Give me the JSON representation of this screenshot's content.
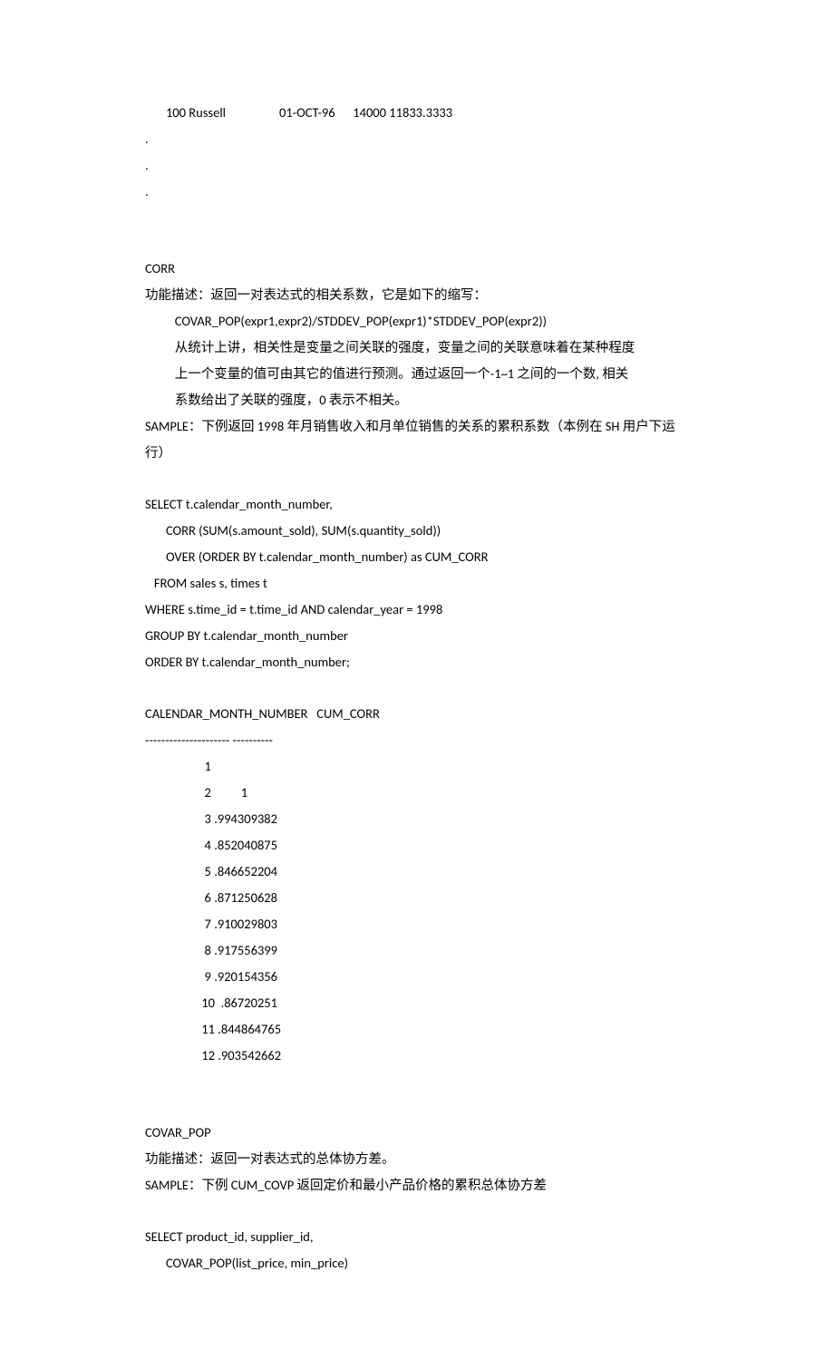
{
  "header_row": "       100 Russell                  01-OCT-96      14000 11833.3333",
  "dot1": ".",
  "dot2": ".",
  "dot3": ".",
  "corr": {
    "title": "CORR",
    "desc_label": "功能描述：返回一对表达式的相关系数，它是如下的缩写：",
    "formula": "          COVAR_POP(expr1,expr2)/STDDEV_POP(expr1)*STDDEV_POP(expr2))",
    "note1": "          从统计上讲，相关性是变量之间关联的强度，变量之间的关联意味着在某种程度",
    "note2": "          上一个变量的值可由其它的值进行预测。通过返回一个-1~1 之间的一个数, 相关",
    "note3": "          系数给出了关联的强度，0 表示不相关。",
    "sample": "SAMPLE：下例返回 1998 年月销售收入和月单位销售的关系的累积系数（本例在 SH 用户下运行）",
    "sql1": "SELECT t.calendar_month_number,",
    "sql2": "       CORR (SUM(s.amount_sold), SUM(s.quantity_sold))",
    "sql3": "       OVER (ORDER BY t.calendar_month_number) as CUM_CORR",
    "sql4": "   FROM sales s, times t",
    "sql5": "WHERE s.time_id = t.time_id AND calendar_year = 1998",
    "sql6": "GROUP BY t.calendar_month_number",
    "sql7": "ORDER BY t.calendar_month_number;",
    "out_header": "CALENDAR_MONTH_NUMBER   CUM_CORR",
    "out_divider": "--------------------- ----------",
    "out_lines": [
      "                    1",
      "                    2          1",
      "                    3 .994309382",
      "                    4 .852040875",
      "                    5 .846652204",
      "                    6 .871250628",
      "                    7 .910029803",
      "                    8 .917556399",
      "                    9 .920154356",
      "                   10  .86720251",
      "                   11 .844864765",
      "                   12 .903542662"
    ]
  },
  "covar": {
    "title": "COVAR_POP",
    "desc": "功能描述：返回一对表达式的总体协方差。",
    "sample": "SAMPLE：下例 CUM_COVP 返回定价和最小产品价格的累积总体协方差",
    "sql1": "SELECT product_id, supplier_id,",
    "sql2": "       COVAR_POP(list_price, min_price)"
  }
}
